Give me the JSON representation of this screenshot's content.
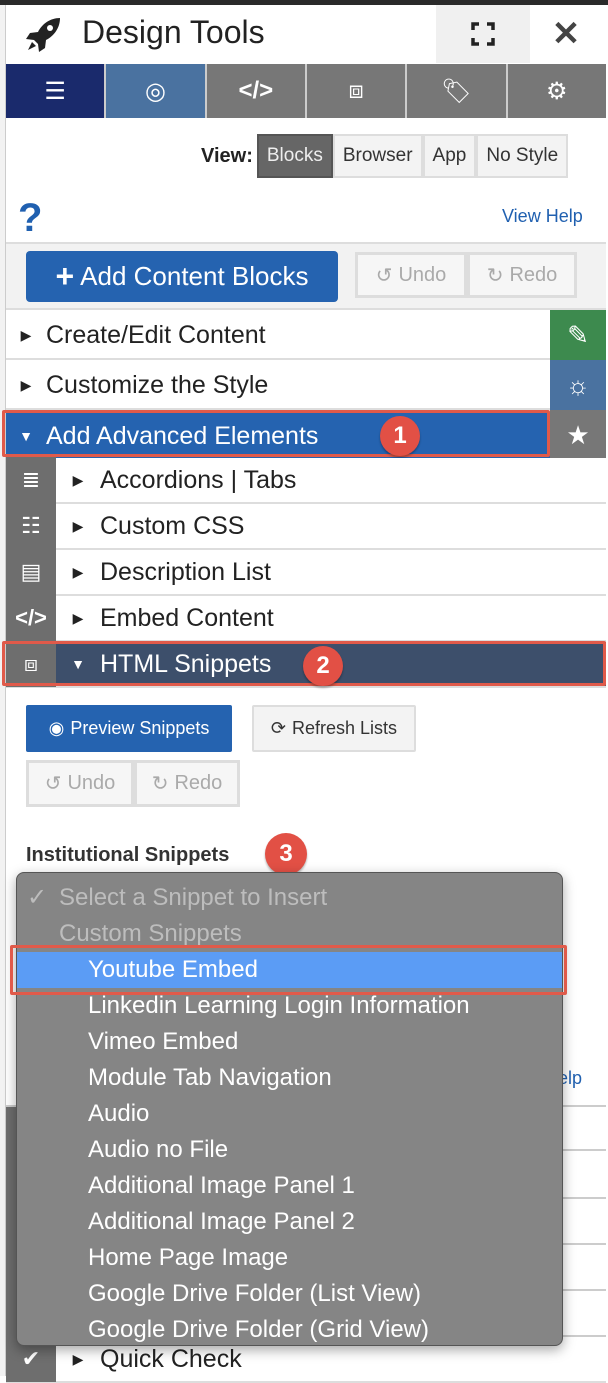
{
  "header": {
    "title": "Design Tools",
    "icon": "rocket-icon",
    "fullscreen_icon": "expand-icon",
    "close_icon": "close-icon",
    "close_glyph": "✕"
  },
  "toolbar": {
    "tabs": [
      {
        "icon": "server-icon",
        "color": "#1a2a6c"
      },
      {
        "icon": "target-icon",
        "color": "#4a72a0"
      },
      {
        "icon": "code-icon",
        "color": "#777777"
      },
      {
        "icon": "cubes-icon",
        "color": "#777777"
      },
      {
        "icon": "tags-icon",
        "color": "#777777"
      },
      {
        "icon": "gears-icon",
        "color": "#777777"
      }
    ]
  },
  "view": {
    "label": "View:",
    "options": [
      "Blocks",
      "Browser",
      "App",
      "No Style"
    ],
    "selected": "Blocks"
  },
  "help": {
    "glyph": "?",
    "link": "View Help"
  },
  "actions": {
    "add": "Add Content Blocks",
    "undo": "Undo",
    "redo": "Redo"
  },
  "accordions": [
    {
      "label": "Create/Edit Content",
      "side_color": "#3d8a4e"
    },
    {
      "label": "Customize the Style",
      "side_color": "#4a72a0"
    },
    {
      "label": "Add Advanced Elements",
      "side_color": "#777777",
      "expanded": true,
      "badge": "1"
    }
  ],
  "advanced": {
    "items": [
      {
        "label": "Accordions | Tabs",
        "icon": "list-icon"
      },
      {
        "label": "Custom CSS",
        "icon": "sliders-icon"
      },
      {
        "label": "Description List",
        "icon": "book-icon"
      },
      {
        "label": "Embed Content",
        "icon": "code-icon"
      },
      {
        "label": "HTML Snippets",
        "icon": "cubes-icon",
        "expanded": true,
        "badge": "2"
      }
    ]
  },
  "snippets": {
    "preview": "Preview Snippets",
    "refresh": "Refresh Lists",
    "undo": "Undo",
    "redo": "Redo",
    "label": "Institutional Snippets",
    "badge": "3",
    "behind_link": "elp",
    "behind_item": "Quick Check"
  },
  "dropdown": {
    "check": "✓",
    "options": [
      {
        "label": "Select a Snippet to Insert",
        "state": "checked-disabled"
      },
      {
        "label": "Custom Snippets",
        "state": "group"
      },
      {
        "label": "Youtube Embed",
        "state": "highlighted"
      },
      {
        "label": "Linkedin Learning Login Information"
      },
      {
        "label": "Vimeo Embed"
      },
      {
        "label": "Module Tab Navigation"
      },
      {
        "label": "Audio"
      },
      {
        "label": "Audio no File"
      },
      {
        "label": "Additional Image Panel 1"
      },
      {
        "label": "Additional Image Panel 2"
      },
      {
        "label": "Home Page Image"
      },
      {
        "label": "Google Drive Folder (List View)"
      },
      {
        "label": "Google Drive Folder (Grid View)"
      }
    ]
  },
  "colors": {
    "primary": "#2563b0",
    "highlight": "#5b9cf5",
    "annotation": "#e25045",
    "snippets_header": "#3d4f6b"
  }
}
